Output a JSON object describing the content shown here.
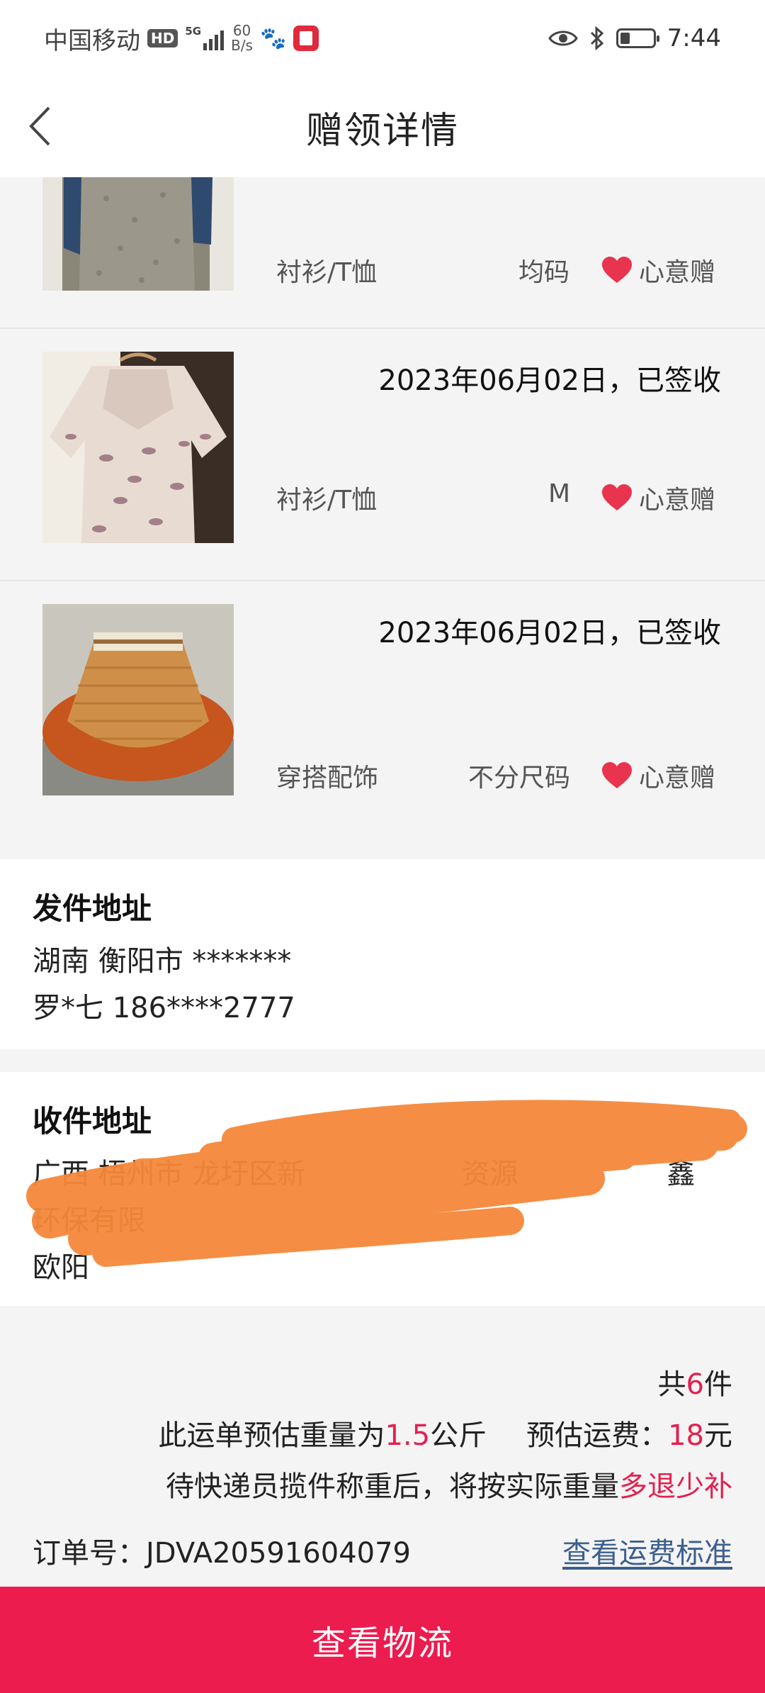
{
  "status_bar": {
    "carrier": "中国移动",
    "hd": "HD",
    "network": "5G",
    "speed_value": "60",
    "speed_unit": "B/s",
    "time": "7:44"
  },
  "header": {
    "title": "赠领详情"
  },
  "items": [
    {
      "category": "衬衫/T恤",
      "size": "均码",
      "tag": "心意赠"
    },
    {
      "date_status": "2023年06月02日，已签收",
      "category": "衬衫/T恤",
      "size": "M",
      "tag": "心意赠"
    },
    {
      "date_status": "2023年06月02日，已签收",
      "category": "穿搭配饰",
      "size": "不分尺码",
      "tag": "心意赠"
    }
  ],
  "sender": {
    "title": "发件地址",
    "region": "湖南 衡阳市 *******",
    "contact": "罗*七 186****2777"
  },
  "receiver": {
    "title": "收件地址",
    "line1": "广西 梧州市 龙圩区新",
    "line1_tail": "资源",
    "line1_end": "鑫",
    "line2": "环保有限",
    "line3": "欧阳"
  },
  "summary": {
    "count_prefix": "共",
    "count": "6",
    "count_suffix": "件",
    "weight_prefix": "此运单预估重量为",
    "weight": "1.5",
    "weight_unit": "公斤",
    "fee_label": "预估运费：",
    "fee": "18",
    "fee_unit": "元",
    "note_prefix": "待快递员揽件称重后，将按实际重量",
    "note_highlight": "多退少补",
    "order_label": "订单号：",
    "order_no": "JDVA20591604079",
    "fee_standard_link": "查看运费标准"
  },
  "footer": {
    "button_label": "查看物流"
  },
  "colors": {
    "accent": "#e3204f",
    "button": "#ec1c4f",
    "link": "#3c5f8f",
    "heart": "#e8344f"
  }
}
